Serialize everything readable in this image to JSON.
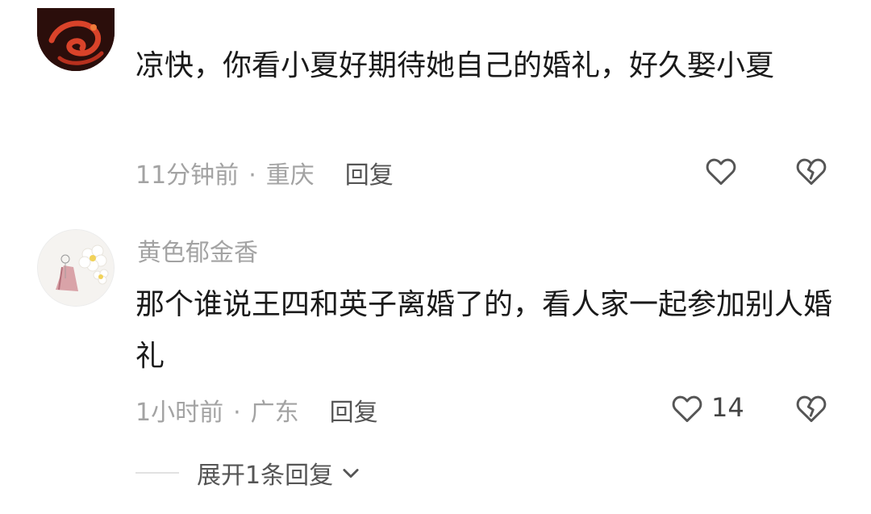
{
  "top_partial_text": "",
  "comments": [
    {
      "username": "",
      "text": "凉快，你看小夏好期待她自己的婚礼，好久娶小夏",
      "time": "11分钟前",
      "separator": "·",
      "location": "重庆",
      "reply_label": "回复",
      "likes": ""
    },
    {
      "username": "黄色郁金香",
      "text": "那个谁说王四和英子离婚了的，看人家一起参加别人婚礼",
      "time": "1小时前",
      "separator": "·",
      "location": "广东",
      "reply_label": "回复",
      "likes": "14"
    }
  ],
  "expand_replies_label": "展开1条回复",
  "icons": {
    "like": "heart-outline-icon",
    "dislike": "broken-heart-icon",
    "expand": "chevron-down-icon"
  },
  "colors": {
    "text": "#1a1a1a",
    "meta": "#a3a3a3",
    "icon": "#555555"
  }
}
